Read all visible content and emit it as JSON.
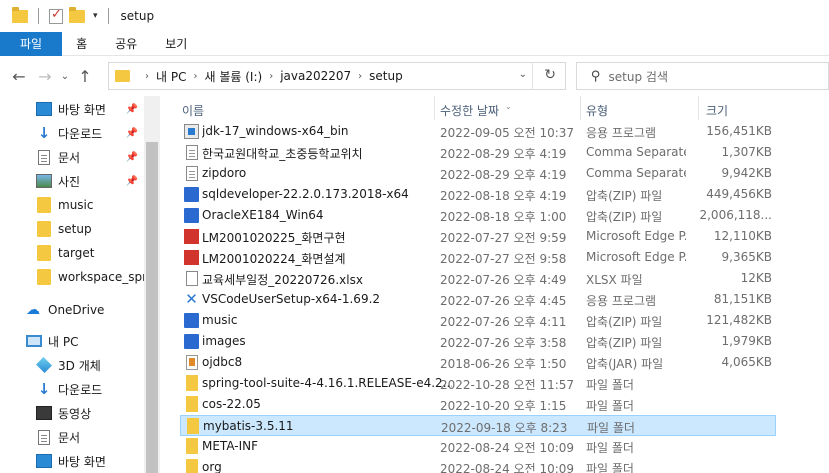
{
  "window": {
    "title": "setup"
  },
  "ribbon": {
    "tabs": [
      "파일",
      "홈",
      "공유",
      "보기"
    ]
  },
  "address": {
    "crumbs": [
      "내 PC",
      "새 볼륨 (I:)",
      "java202207",
      "setup"
    ]
  },
  "search": {
    "placeholder": "setup 검색"
  },
  "nav": {
    "items": [
      {
        "label": "바탕 화면",
        "icon": "desktop-icon",
        "pinned": true
      },
      {
        "label": "다운로드",
        "icon": "download-icon",
        "pinned": true
      },
      {
        "label": "문서",
        "icon": "document-icon",
        "pinned": true
      },
      {
        "label": "사진",
        "icon": "picture-icon",
        "pinned": true
      },
      {
        "label": "music",
        "icon": "folder-icon",
        "pinned": false
      },
      {
        "label": "setup",
        "icon": "folder-icon",
        "pinned": false
      },
      {
        "label": "target",
        "icon": "folder-icon",
        "pinned": false
      },
      {
        "label": "workspace_sprin",
        "icon": "folder-icon",
        "pinned": false
      },
      {
        "label": "OneDrive",
        "icon": "cloud-icon",
        "pinned": false
      },
      {
        "label": "내 PC",
        "icon": "pc-icon",
        "pinned": false
      },
      {
        "label": "3D 개체",
        "icon": "3d-objects-icon",
        "pinned": false
      },
      {
        "label": "다운로드",
        "icon": "download-icon",
        "pinned": false
      },
      {
        "label": "동영상",
        "icon": "video-icon",
        "pinned": false
      },
      {
        "label": "문서",
        "icon": "document-icon",
        "pinned": false
      },
      {
        "label": "바탕 화면",
        "icon": "desktop-icon",
        "pinned": false
      }
    ]
  },
  "columns": {
    "name": "이름",
    "modified": "수정한 날짜",
    "type": "유형",
    "size": "크기"
  },
  "files": [
    {
      "name": "jdk-17_windows-x64_bin",
      "date": "2022-09-05 오전 10:37",
      "type": "응용 프로그램",
      "size": "156,451KB",
      "icon": "installer-icon"
    },
    {
      "name": "한국교원대학교_초중등학교위치",
      "date": "2022-08-29 오후 4:19",
      "type": "Comma Separated...",
      "size": "1,307KB",
      "icon": "text-file-icon"
    },
    {
      "name": "zipdoro",
      "date": "2022-08-29 오후 4:19",
      "type": "Comma Separated...",
      "size": "9,942KB",
      "icon": "text-file-icon"
    },
    {
      "name": "sqldeveloper-22.2.0.173.2018-x64",
      "date": "2022-08-18 오후 4:19",
      "type": "압축(ZIP) 파일",
      "size": "449,456KB",
      "icon": "zip-icon"
    },
    {
      "name": "OracleXE184_Win64",
      "date": "2022-08-18 오후 1:00",
      "type": "압축(ZIP) 파일",
      "size": "2,006,118...",
      "icon": "zip-icon"
    },
    {
      "name": "LM2001020225_화면구현",
      "date": "2022-07-27 오전 9:59",
      "type": "Microsoft Edge P...",
      "size": "12,110KB",
      "icon": "pdf-icon"
    },
    {
      "name": "LM2001020224_화면설계",
      "date": "2022-07-27 오전 9:58",
      "type": "Microsoft Edge P...",
      "size": "9,365KB",
      "icon": "pdf-icon"
    },
    {
      "name": "교육세부일정_20220726.xlsx",
      "date": "2022-07-26 오후 4:49",
      "type": "XLSX 파일",
      "size": "12KB",
      "icon": "xlsx-icon"
    },
    {
      "name": "VSCodeUserSetup-x64-1.69.2",
      "date": "2022-07-26 오후 4:45",
      "type": "응용 프로그램",
      "size": "81,151KB",
      "icon": "vscode-icon"
    },
    {
      "name": "music",
      "date": "2022-07-26 오후 4:11",
      "type": "압축(ZIP) 파일",
      "size": "121,482KB",
      "icon": "zip-icon"
    },
    {
      "name": "images",
      "date": "2022-07-26 오후 3:58",
      "type": "압축(ZIP) 파일",
      "size": "1,979KB",
      "icon": "zip-icon"
    },
    {
      "name": "ojdbc8",
      "date": "2018-06-26 오후 1:50",
      "type": "압축(JAR) 파일",
      "size": "4,065KB",
      "icon": "jar-icon"
    },
    {
      "name": "spring-tool-suite-4-4.16.1.RELEASE-e4.2...",
      "date": "2022-10-28 오전 11:57",
      "type": "파일 폴더",
      "size": "",
      "icon": "folder-icon"
    },
    {
      "name": "cos-22.05",
      "date": "2022-10-20 오후 1:15",
      "type": "파일 폴더",
      "size": "",
      "icon": "folder-icon"
    },
    {
      "name": "mybatis-3.5.11",
      "date": "2022-09-18 오후 8:23",
      "type": "파일 폴더",
      "size": "",
      "icon": "folder-icon",
      "selected": true
    },
    {
      "name": "META-INF",
      "date": "2022-08-24 오전 10:09",
      "type": "파일 폴더",
      "size": "",
      "icon": "folder-icon"
    },
    {
      "name": "org",
      "date": "2022-08-24 오전 10:09",
      "type": "파일 폴더",
      "size": "",
      "icon": "folder-icon"
    }
  ]
}
